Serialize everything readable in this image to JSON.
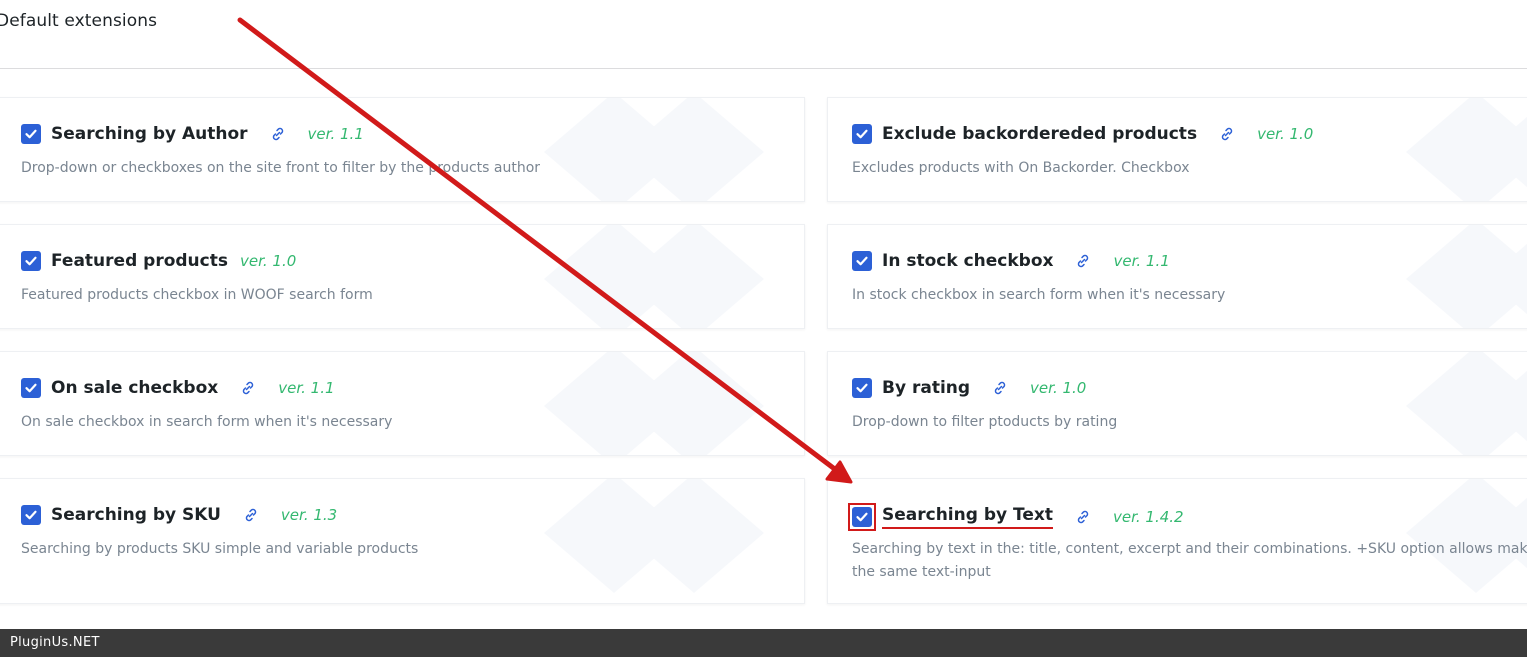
{
  "page": {
    "title": "Default extensions"
  },
  "colors": {
    "checkbox": "#2c60d6",
    "version": "#34b870",
    "annotation": "#d11a1a",
    "footer_bg": "#3a3a3a"
  },
  "extensions": [
    {
      "title": "Searching by Author",
      "has_link": true,
      "version": "ver. 1.1",
      "description": "Drop-down or checkboxes on the site front to filter by the products author",
      "checked": true
    },
    {
      "title": "Exclude backorderedеd products",
      "has_link": true,
      "version": "ver. 1.0",
      "description": "Excludes products with On Backorder. Checkbox",
      "checked": true
    },
    {
      "title": "Featured products",
      "has_link": false,
      "version": "ver. 1.0",
      "description": "Featured products checkbox in WOOF search form",
      "checked": true
    },
    {
      "title": "In stock checkbox",
      "has_link": true,
      "version": "ver. 1.1",
      "description": "In stock checkbox in search form when it's necessary",
      "checked": true
    },
    {
      "title": "On sale checkbox",
      "has_link": true,
      "version": "ver. 1.1",
      "description": "On sale checkbox in search form when it's necessary",
      "checked": true
    },
    {
      "title": "By rating",
      "has_link": true,
      "version": "ver. 1.0",
      "description": "Drop-down to filter ptoducts by rating",
      "checked": true
    },
    {
      "title": "Searching by SKU",
      "has_link": true,
      "version": "ver. 1.3",
      "description": "Searching by products SKU simple and variable products",
      "checked": true
    },
    {
      "title": "Searching by Text",
      "has_link": true,
      "version": "ver. 1.4.2",
      "description": "Searching by text in the: title, content, excerpt and their combinations. +SKU option allows making",
      "description_line2": "the same text-input",
      "checked": true,
      "highlighted": true
    }
  ],
  "icons": {
    "checkbox": "checkmark-icon",
    "link": "link-icon",
    "background": "box-logo-icon"
  },
  "footer": {
    "text": "PluginUs.NET"
  }
}
